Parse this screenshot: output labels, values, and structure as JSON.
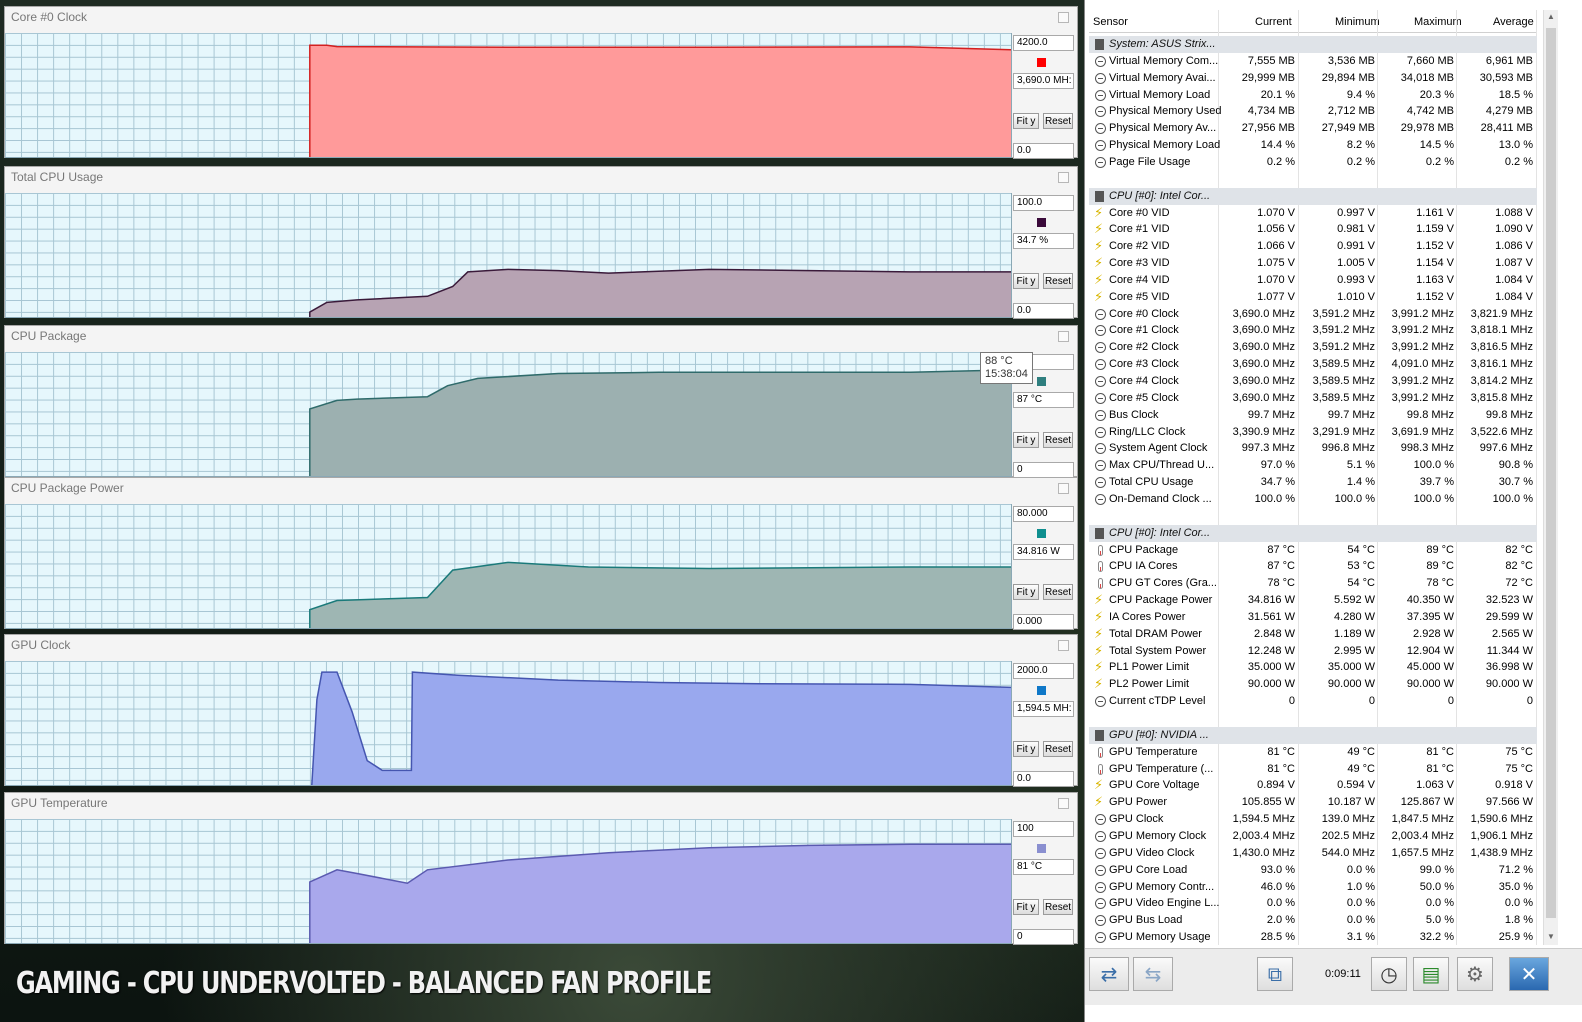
{
  "banner": "GAMING - CPU UNDERVOLTED - BALANCED FAN PROFILE",
  "graphs": [
    {
      "title": "Core #0 Clock",
      "top": "4200.0",
      "current": "3,690.0 MH:",
      "bottom": "0.0",
      "color": "#ff0000",
      "fill": "#ff9a9a",
      "line": "#d32020",
      "max": 4200,
      "data": [
        [
          0,
          0
        ],
        [
          0.303,
          0
        ],
        [
          0.303,
          3850
        ],
        [
          0.32,
          3850
        ],
        [
          0.33,
          3800
        ],
        [
          0.5,
          3780
        ],
        [
          0.7,
          3780
        ],
        [
          0.9,
          3790
        ],
        [
          1.0,
          3690
        ]
      ]
    },
    {
      "title": "Total CPU Usage",
      "top": "100.0",
      "current": "34.7 %",
      "bottom": "0.0",
      "color": "#3a0a3a",
      "fill": "#b7a3b3",
      "line": "#3a1a3a",
      "max": 100,
      "data": [
        [
          0,
          0
        ],
        [
          0.303,
          0
        ],
        [
          0.303,
          4
        ],
        [
          0.32,
          12
        ],
        [
          0.35,
          14
        ],
        [
          0.42,
          17
        ],
        [
          0.445,
          25
        ],
        [
          0.46,
          37
        ],
        [
          0.5,
          39
        ],
        [
          0.55,
          38
        ],
        [
          0.6,
          36
        ],
        [
          0.7,
          39
        ],
        [
          0.8,
          38
        ],
        [
          0.9,
          37
        ],
        [
          1.0,
          37
        ]
      ]
    },
    {
      "title": "CPU Package",
      "top": "",
      "current": "87 °C",
      "bottom": "0",
      "color": "#2f7f7f",
      "fill": "#9cb0b0",
      "line": "#2f6b6b",
      "max": 100,
      "data": [
        [
          0,
          0
        ],
        [
          0.303,
          0
        ],
        [
          0.303,
          55
        ],
        [
          0.33,
          62
        ],
        [
          0.35,
          63
        ],
        [
          0.42,
          65
        ],
        [
          0.44,
          74
        ],
        [
          0.47,
          80
        ],
        [
          0.55,
          84
        ],
        [
          0.65,
          85
        ],
        [
          0.8,
          85
        ],
        [
          0.9,
          85
        ],
        [
          1.0,
          87
        ]
      ]
    },
    {
      "title": "CPU Package Power",
      "top": "80.000",
      "current": "34.816 W",
      "bottom": "0.000",
      "color": "#0f8f8f",
      "fill": "#9eb6b3",
      "line": "#1a7a7a",
      "max": 80,
      "data": [
        [
          0,
          0
        ],
        [
          0.303,
          0
        ],
        [
          0.303,
          12
        ],
        [
          0.33,
          18
        ],
        [
          0.42,
          20
        ],
        [
          0.445,
          38
        ],
        [
          0.5,
          43
        ],
        [
          0.58,
          40
        ],
        [
          0.7,
          39
        ],
        [
          0.9,
          40
        ],
        [
          1.0,
          40
        ]
      ]
    },
    {
      "title": "GPU Clock",
      "top": "2000.0",
      "current": "1,594.5 MH:",
      "bottom": "0.0",
      "color": "#0f78c8",
      "fill": "#99a8ee",
      "line": "#4556b0",
      "max": 2000,
      "data": [
        [
          0,
          0
        ],
        [
          0.305,
          0
        ],
        [
          0.31,
          1400
        ],
        [
          0.315,
          1850
        ],
        [
          0.33,
          1850
        ],
        [
          0.345,
          1200
        ],
        [
          0.36,
          400
        ],
        [
          0.375,
          240
        ],
        [
          0.404,
          240
        ],
        [
          0.405,
          1850
        ],
        [
          0.45,
          1800
        ],
        [
          0.55,
          1720
        ],
        [
          0.65,
          1680
        ],
        [
          0.75,
          1660
        ],
        [
          0.9,
          1650
        ],
        [
          1.0,
          1600
        ]
      ]
    },
    {
      "title": "GPU Temperature",
      "top": "100",
      "current": "81 °C",
      "bottom": "0",
      "color": "#8a8fd0",
      "fill": "#a9a8ec",
      "line": "#5a5ab0",
      "max": 100,
      "data": [
        [
          0,
          0
        ],
        [
          0.303,
          0
        ],
        [
          0.303,
          50
        ],
        [
          0.33,
          60
        ],
        [
          0.35,
          57
        ],
        [
          0.4,
          49
        ],
        [
          0.42,
          60
        ],
        [
          0.5,
          68
        ],
        [
          0.6,
          74
        ],
        [
          0.7,
          78
        ],
        [
          0.8,
          80
        ],
        [
          0.9,
          81
        ],
        [
          1.0,
          81
        ]
      ]
    }
  ],
  "tooltip": {
    "line1": "88 °C",
    "line2": "15:38:04"
  },
  "buttons": {
    "fit": "Fit y",
    "reset": "Reset"
  },
  "sensor_header": {
    "sensor": "Sensor",
    "current": "Current",
    "minimum": "Minimum",
    "maximum": "Maximum",
    "average": "Average"
  },
  "sensor_rows": [
    {
      "t": "group",
      "n": "System: ASUS Strix..."
    },
    {
      "t": "clock",
      "n": "Virtual Memory Com...",
      "c": "7,555 MB",
      "mi": "3,536 MB",
      "ma": "7,660 MB",
      "a": "6,961 MB"
    },
    {
      "t": "clock",
      "n": "Virtual Memory Avai...",
      "c": "29,999 MB",
      "mi": "29,894 MB",
      "ma": "34,018 MB",
      "a": "30,593 MB"
    },
    {
      "t": "clock",
      "n": "Virtual Memory Load",
      "c": "20.1 %",
      "mi": "9.4 %",
      "ma": "20.3 %",
      "a": "18.5 %"
    },
    {
      "t": "clock",
      "n": "Physical Memory Used",
      "c": "4,734 MB",
      "mi": "2,712 MB",
      "ma": "4,742 MB",
      "a": "4,279 MB"
    },
    {
      "t": "clock",
      "n": "Physical Memory Av...",
      "c": "27,956 MB",
      "mi": "27,949 MB",
      "ma": "29,978 MB",
      "a": "28,411 MB"
    },
    {
      "t": "clock",
      "n": "Physical Memory Load",
      "c": "14.4 %",
      "mi": "8.2 %",
      "ma": "14.5 %",
      "a": "13.0 %"
    },
    {
      "t": "clock",
      "n": "Page File Usage",
      "c": "0.2 %",
      "mi": "0.2 %",
      "ma": "0.2 %",
      "a": "0.2 %"
    },
    {
      "t": "blank"
    },
    {
      "t": "group",
      "n": "CPU [#0]: Intel Cor..."
    },
    {
      "t": "bolt",
      "n": "Core #0 VID",
      "c": "1.070 V",
      "mi": "0.997 V",
      "ma": "1.161 V",
      "a": "1.088 V"
    },
    {
      "t": "bolt",
      "n": "Core #1 VID",
      "c": "1.056 V",
      "mi": "0.981 V",
      "ma": "1.159 V",
      "a": "1.090 V"
    },
    {
      "t": "bolt",
      "n": "Core #2 VID",
      "c": "1.066 V",
      "mi": "0.991 V",
      "ma": "1.152 V",
      "a": "1.086 V"
    },
    {
      "t": "bolt",
      "n": "Core #3 VID",
      "c": "1.075 V",
      "mi": "1.005 V",
      "ma": "1.154 V",
      "a": "1.087 V"
    },
    {
      "t": "bolt",
      "n": "Core #4 VID",
      "c": "1.070 V",
      "mi": "0.993 V",
      "ma": "1.163 V",
      "a": "1.084 V"
    },
    {
      "t": "bolt",
      "n": "Core #5 VID",
      "c": "1.077 V",
      "mi": "1.010 V",
      "ma": "1.152 V",
      "a": "1.084 V"
    },
    {
      "t": "clock",
      "n": "Core #0 Clock",
      "c": "3,690.0 MHz",
      "mi": "3,591.2 MHz",
      "ma": "3,991.2 MHz",
      "a": "3,821.9 MHz"
    },
    {
      "t": "clock",
      "n": "Core #1 Clock",
      "c": "3,690.0 MHz",
      "mi": "3,591.2 MHz",
      "ma": "3,991.2 MHz",
      "a": "3,818.1 MHz"
    },
    {
      "t": "clock",
      "n": "Core #2 Clock",
      "c": "3,690.0 MHz",
      "mi": "3,591.2 MHz",
      "ma": "3,991.2 MHz",
      "a": "3,816.5 MHz"
    },
    {
      "t": "clock",
      "n": "Core #3 Clock",
      "c": "3,690.0 MHz",
      "mi": "3,589.5 MHz",
      "ma": "4,091.0 MHz",
      "a": "3,816.1 MHz"
    },
    {
      "t": "clock",
      "n": "Core #4 Clock",
      "c": "3,690.0 MHz",
      "mi": "3,589.5 MHz",
      "ma": "3,991.2 MHz",
      "a": "3,814.2 MHz"
    },
    {
      "t": "clock",
      "n": "Core #5 Clock",
      "c": "3,690.0 MHz",
      "mi": "3,589.5 MHz",
      "ma": "3,991.2 MHz",
      "a": "3,815.8 MHz"
    },
    {
      "t": "clock",
      "n": "Bus Clock",
      "c": "99.7 MHz",
      "mi": "99.7 MHz",
      "ma": "99.8 MHz",
      "a": "99.8 MHz"
    },
    {
      "t": "clock",
      "n": "Ring/LLC Clock",
      "c": "3,390.9 MHz",
      "mi": "3,291.9 MHz",
      "ma": "3,691.9 MHz",
      "a": "3,522.6 MHz"
    },
    {
      "t": "clock",
      "n": "System Agent Clock",
      "c": "997.3 MHz",
      "mi": "996.8 MHz",
      "ma": "998.3 MHz",
      "a": "997.6 MHz"
    },
    {
      "t": "clock",
      "n": "Max CPU/Thread U...",
      "c": "97.0 %",
      "mi": "5.1 %",
      "ma": "100.0 %",
      "a": "90.8 %"
    },
    {
      "t": "clock",
      "n": "Total CPU Usage",
      "c": "34.7 %",
      "mi": "1.4 %",
      "ma": "39.7 %",
      "a": "30.7 %"
    },
    {
      "t": "clock",
      "n": "On-Demand Clock ...",
      "c": "100.0 %",
      "mi": "100.0 %",
      "ma": "100.0 %",
      "a": "100.0 %"
    },
    {
      "t": "blank"
    },
    {
      "t": "group",
      "n": "CPU [#0]: Intel Cor..."
    },
    {
      "t": "therm",
      "n": "CPU Package",
      "c": "87 °C",
      "mi": "54 °C",
      "ma": "89 °C",
      "a": "82 °C"
    },
    {
      "t": "therm",
      "n": "CPU IA Cores",
      "c": "87 °C",
      "mi": "53 °C",
      "ma": "89 °C",
      "a": "82 °C"
    },
    {
      "t": "therm",
      "n": "CPU GT Cores (Gra...",
      "c": "78 °C",
      "mi": "54 °C",
      "ma": "78 °C",
      "a": "72 °C"
    },
    {
      "t": "bolt",
      "n": "CPU Package Power",
      "c": "34.816 W",
      "mi": "5.592 W",
      "ma": "40.350 W",
      "a": "32.523 W"
    },
    {
      "t": "bolt",
      "n": "IA Cores Power",
      "c": "31.561 W",
      "mi": "4.280 W",
      "ma": "37.395 W",
      "a": "29.599 W"
    },
    {
      "t": "bolt",
      "n": "Total DRAM Power",
      "c": "2.848 W",
      "mi": "1.189 W",
      "ma": "2.928 W",
      "a": "2.565 W"
    },
    {
      "t": "bolt",
      "n": "Total System Power",
      "c": "12.248 W",
      "mi": "2.995 W",
      "ma": "12.904 W",
      "a": "11.344 W"
    },
    {
      "t": "bolt",
      "n": "PL1 Power Limit",
      "c": "35.000 W",
      "mi": "35.000 W",
      "ma": "45.000 W",
      "a": "36.998 W"
    },
    {
      "t": "bolt",
      "n": "PL2 Power Limit",
      "c": "90.000 W",
      "mi": "90.000 W",
      "ma": "90.000 W",
      "a": "90.000 W"
    },
    {
      "t": "clock",
      "n": "Current cTDP Level",
      "c": "0",
      "mi": "0",
      "ma": "0",
      "a": "0"
    },
    {
      "t": "blank"
    },
    {
      "t": "group",
      "n": "GPU [#0]: NVIDIA ..."
    },
    {
      "t": "therm",
      "n": "GPU Temperature",
      "c": "81 °C",
      "mi": "49 °C",
      "ma": "81 °C",
      "a": "75 °C"
    },
    {
      "t": "therm",
      "n": "GPU Temperature (...",
      "c": "81 °C",
      "mi": "49 °C",
      "ma": "81 °C",
      "a": "75 °C"
    },
    {
      "t": "bolt",
      "n": "GPU Core Voltage",
      "c": "0.894 V",
      "mi": "0.594 V",
      "ma": "1.063 V",
      "a": "0.918 V"
    },
    {
      "t": "bolt",
      "n": "GPU Power",
      "c": "105.855 W",
      "mi": "10.187 W",
      "ma": "125.867 W",
      "a": "97.566 W"
    },
    {
      "t": "clock",
      "n": "GPU Clock",
      "c": "1,594.5 MHz",
      "mi": "139.0 MHz",
      "ma": "1,847.5 MHz",
      "a": "1,590.6 MHz"
    },
    {
      "t": "clock",
      "n": "GPU Memory Clock",
      "c": "2,003.4 MHz",
      "mi": "202.5 MHz",
      "ma": "2,003.4 MHz",
      "a": "1,906.1 MHz"
    },
    {
      "t": "clock",
      "n": "GPU Video Clock",
      "c": "1,430.0 MHz",
      "mi": "544.0 MHz",
      "ma": "1,657.5 MHz",
      "a": "1,438.9 MHz"
    },
    {
      "t": "clock",
      "n": "GPU Core Load",
      "c": "93.0 %",
      "mi": "0.0 %",
      "ma": "99.0 %",
      "a": "71.2 %"
    },
    {
      "t": "clock",
      "n": "GPU Memory Contr...",
      "c": "46.0 %",
      "mi": "1.0 %",
      "ma": "50.0 %",
      "a": "35.0 %"
    },
    {
      "t": "clock",
      "n": "GPU Video Engine L...",
      "c": "0.0 %",
      "mi": "0.0 %",
      "ma": "0.0 %",
      "a": "0.0 %"
    },
    {
      "t": "clock",
      "n": "GPU Bus Load",
      "c": "2.0 %",
      "mi": "0.0 %",
      "ma": "5.0 %",
      "a": "1.8 %"
    },
    {
      "t": "clock",
      "n": "GPU Memory Usage",
      "c": "28.5 %",
      "mi": "3.1 %",
      "ma": "32.2 %",
      "a": "25.9 %"
    }
  ],
  "toolbar": {
    "timer": "0:09:11"
  }
}
